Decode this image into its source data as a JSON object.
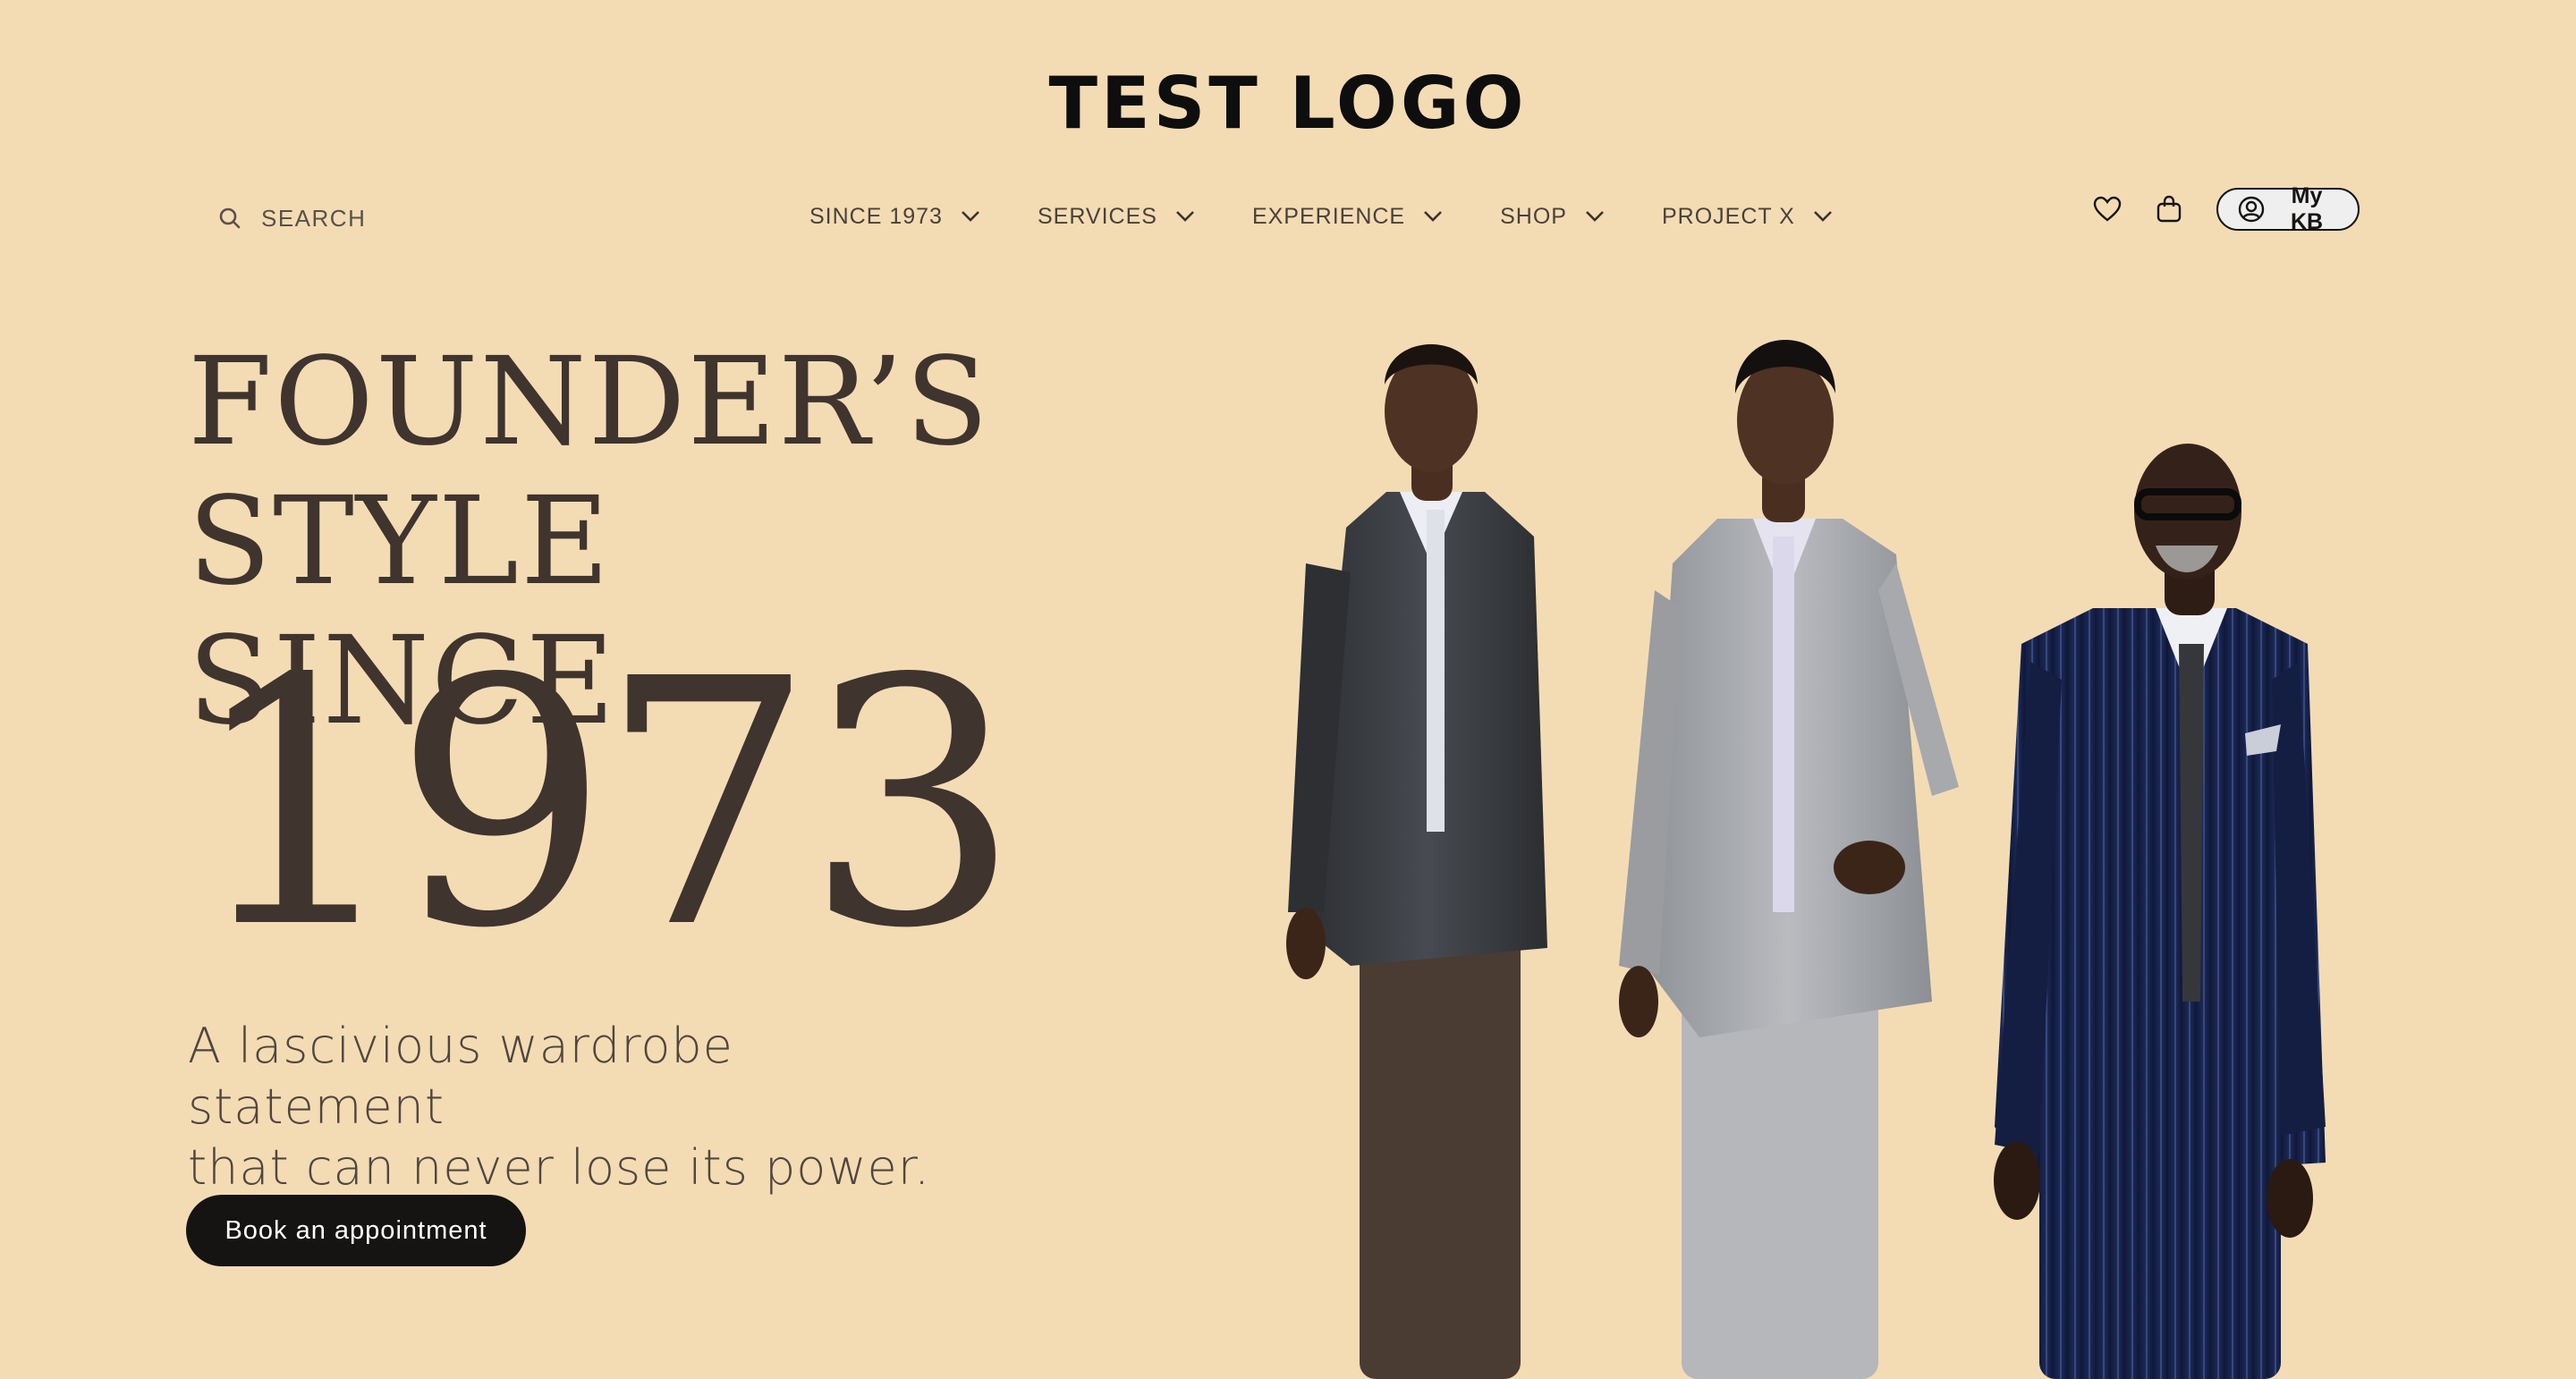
{
  "header": {
    "logo": "TEST LOGO",
    "search_label": "SEARCH",
    "nav": [
      {
        "label": "SINCE 1973"
      },
      {
        "label": "SERVICES"
      },
      {
        "label": "EXPERIENCE"
      },
      {
        "label": "SHOP"
      },
      {
        "label": "PROJECT X"
      }
    ],
    "icons": [
      "search-icon",
      "chevron-down-icon",
      "heart-icon",
      "bag-icon",
      "user-circle-icon"
    ],
    "account_label": "My KB"
  },
  "hero": {
    "headline_line1": "FOUNDER’S",
    "headline_line2": "STYLE SINCE",
    "year": "1973",
    "subtitle_line1": "A lascivious wardrobe statement",
    "subtitle_line2": "that can never lose its power.",
    "cta_label": "Book an appointment"
  },
  "colors": {
    "background": "#f3dcb4",
    "text": "#3f342e",
    "button": "#161412",
    "button_text": "#ffffff"
  }
}
